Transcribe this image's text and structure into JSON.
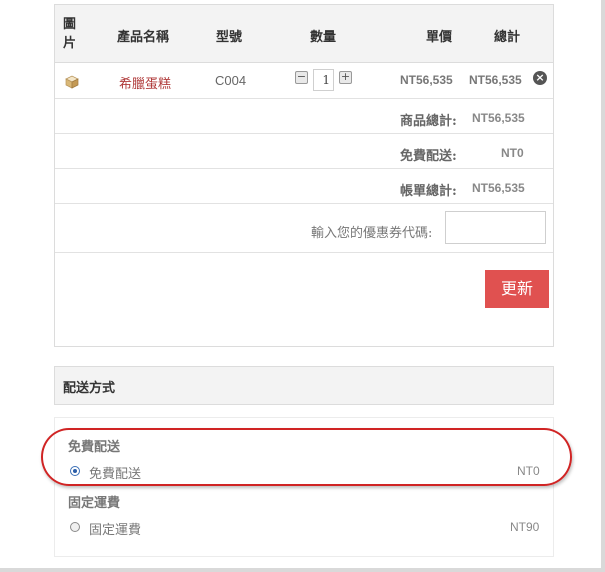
{
  "cart": {
    "columns": {
      "image": "圖片",
      "name": "產品名稱",
      "model": "型號",
      "quantity": "數量",
      "unit_price": "單價",
      "total": "總計"
    },
    "item": {
      "name": "希臘蛋糕",
      "model": "C004",
      "quantity": "1",
      "minus": "−",
      "plus": "+",
      "unit_price": "NT56,535",
      "total": "NT56,535",
      "remove": "×",
      "icon": "cake-icon"
    },
    "summary": [
      {
        "label": "商品總計:",
        "value": "NT56,535"
      },
      {
        "label": "免費配送:",
        "value": "NT0"
      },
      {
        "label": "帳單總計:",
        "value": "NT56,535"
      }
    ],
    "coupon_label": "輸入您的優惠券代碼:",
    "coupon_value": "",
    "update_button": "更新"
  },
  "shipping": {
    "title": "配送方式",
    "groups": [
      {
        "title": "免費配送",
        "option": "免費配送",
        "price": "NT0",
        "selected": true
      },
      {
        "title": "固定運費",
        "option": "固定運費",
        "price": "NT90",
        "selected": false
      }
    ]
  },
  "colors": {
    "accent_button": "#e05150",
    "product_link": "#b03a3a",
    "annotation": "#d02424"
  }
}
